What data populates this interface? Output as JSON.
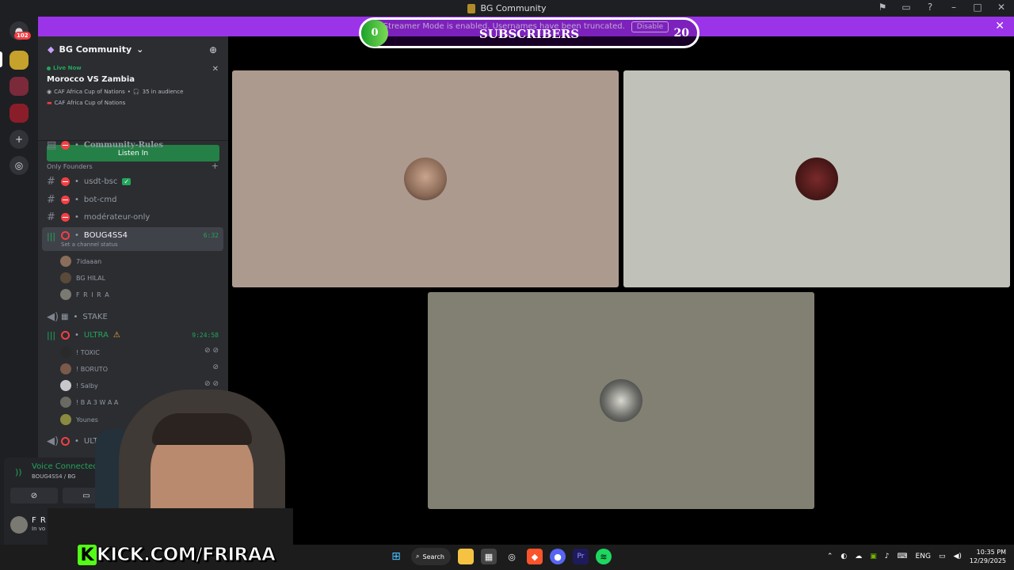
{
  "window": {
    "title": "BG Community"
  },
  "banner": {
    "text": "Streamer Mode is enabled. Usernames have been truncated.",
    "disable_label": "Disable",
    "color": "#9b34e8"
  },
  "sub_widget": {
    "current": "0",
    "label": "SUBSCRIBERS",
    "goal": "20"
  },
  "rail": {
    "dm_badge": "102"
  },
  "server": {
    "name": "BG Community"
  },
  "live": {
    "status": "Live Now",
    "title": "Morocco VS Zambia",
    "event": "CAF Africa Cup of Nations",
    "audience": "35 in audience",
    "channel": "CAF Africa Cup of Nations",
    "button": "Listen In"
  },
  "channels": {
    "rules": "Community-Rules",
    "category": "Only Founders",
    "c1": "usdt-bsc",
    "c2": "bot-cmd",
    "c3": "modérateur-only",
    "voice1": {
      "name": "BOUG4SS4",
      "timer": "6:32",
      "status": "Set a channel status"
    },
    "voice1_users": [
      "7idaaan",
      "BG HILAL",
      "F R I R A"
    ],
    "voice2": "STAKE",
    "voice3": {
      "name": "ULTRA",
      "timer": "9:24:58"
    },
    "voice3_users": [
      "! TOXIC",
      "! BORUTO",
      "! Salby",
      "! B A 3 W A A",
      "Younes"
    ],
    "voice4": "ULTR"
  },
  "voice_panel": {
    "title": "Voice Connected",
    "sub": "BOUG4SS4 / BG",
    "user": "F R I R A",
    "user_status": "In vo"
  },
  "stream": {
    "tile_colors": [
      "#ad9a8f",
      "#c0c2ba",
      "#818072"
    ]
  },
  "overlay": {
    "kick_url": "KICK.COM/FRIRAA",
    "kick_k": "K"
  },
  "taskbar": {
    "search": "Search",
    "lang": "ENG",
    "time": "10:35 PM",
    "date": "12/29/2025"
  }
}
